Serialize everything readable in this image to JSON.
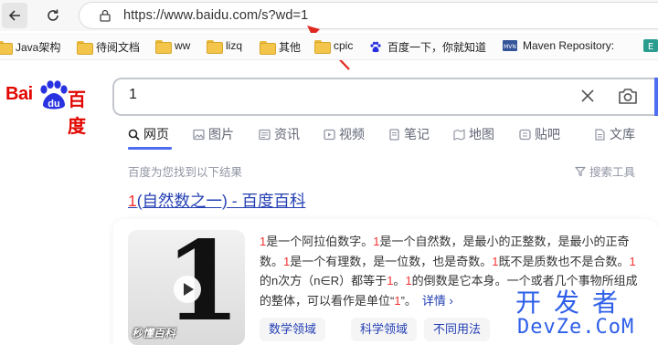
{
  "browser": {
    "url": "https://www.baidu.com/s?wd=1",
    "bookmarks": [
      {
        "label": "Java架构",
        "icon": "folder-icon"
      },
      {
        "label": "待阅文档",
        "icon": "folder-icon"
      },
      {
        "label": "ww",
        "icon": "folder-icon"
      },
      {
        "label": "lizq",
        "icon": "folder-icon"
      },
      {
        "label": "其他",
        "icon": "folder-icon"
      },
      {
        "label": "cpic",
        "icon": "folder-icon"
      },
      {
        "label": "百度一下，你就知道",
        "icon": "baidu-paw-icon"
      },
      {
        "label": "Maven Repository:",
        "icon": "mvn-icon"
      }
    ]
  },
  "baidu": {
    "logo_text": "Bai",
    "logo_du": "du",
    "logo_cn": "百度",
    "query": "1",
    "tabs": [
      {
        "label": "网页",
        "icon": "search-icon"
      },
      {
        "label": "图片",
        "icon": "image-icon"
      },
      {
        "label": "资讯",
        "icon": "news-icon"
      },
      {
        "label": "视频",
        "icon": "video-icon"
      },
      {
        "label": "笔记",
        "icon": "note-icon"
      },
      {
        "label": "地图",
        "icon": "map-icon"
      },
      {
        "label": "贴吧",
        "icon": "tieba-icon"
      },
      {
        "label": "文库",
        "icon": "doc-icon"
      }
    ],
    "result_stats": "百度为您找到以下结果",
    "search_tools": "搜索工具",
    "result": {
      "title_highlight": "1",
      "title_rest": "(自然数之一) - 百度百科",
      "thumb_digit": "1",
      "thumb_caption": "秒懂百科",
      "desc_parts": [
        {
          "t": "1",
          "hl": true
        },
        {
          "t": "是一个阿拉伯数字。",
          "hl": false
        },
        {
          "t": "1",
          "hl": true
        },
        {
          "t": "是一个自然数，是最小的正整数，是最小的正奇数。",
          "hl": false
        },
        {
          "t": "1",
          "hl": true
        },
        {
          "t": "是一个有理数，是一位数，也是奇数。",
          "hl": false
        },
        {
          "t": "1",
          "hl": true
        },
        {
          "t": "既不是质数也不是合数。",
          "hl": false
        },
        {
          "t": "1",
          "hl": true
        },
        {
          "t": "的n次方（n∈R）都等于",
          "hl": false
        },
        {
          "t": "1",
          "hl": true
        },
        {
          "t": "。",
          "hl": false
        },
        {
          "t": "1",
          "hl": true
        },
        {
          "t": "的倒数是它本身。一个或者几个事物所组成的整体，可以看作是单位“",
          "hl": false
        },
        {
          "t": "1",
          "hl": true
        },
        {
          "t": "”。",
          "hl": false
        }
      ],
      "more_label": "详情 ›",
      "chips": [
        "数学领域",
        "科学领域",
        "不同用法"
      ]
    }
  },
  "watermark": {
    "line1": "开发者",
    "line2": "DevZe.CoM"
  },
  "colors": {
    "brand_red": "#e10601",
    "brand_blue": "#2932e1",
    "link_blue": "#2440b3",
    "highlight_red": "#f73131",
    "accent": "#4e6ef2"
  }
}
